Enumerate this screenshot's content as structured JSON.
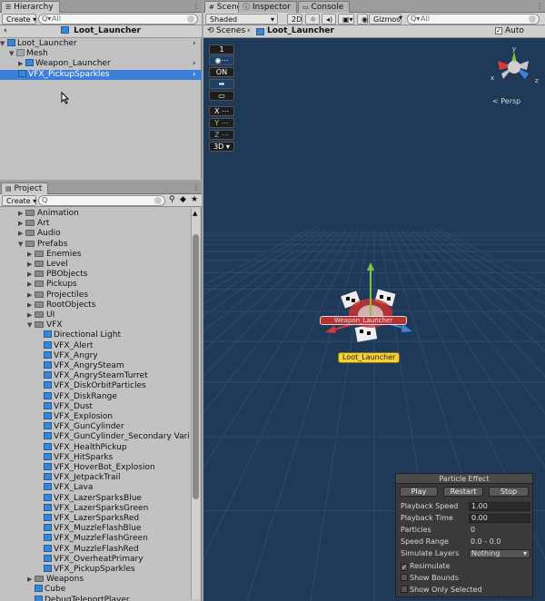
{
  "hierarchy": {
    "tab_label": "Hierarchy",
    "create_label": "Create",
    "search_placeholder": "All",
    "breadcrumb": "Loot_Launcher",
    "items": [
      {
        "label": "Loot_Launcher"
      },
      {
        "label": "Mesh"
      },
      {
        "label": "Weapon_Launcher"
      },
      {
        "label": "VFX_PickupSparkles"
      }
    ]
  },
  "project": {
    "tab_label": "Project",
    "create_label": "Create",
    "items": [
      {
        "label": "Animation"
      },
      {
        "label": "Art"
      },
      {
        "label": "Audio"
      },
      {
        "label": "Prefabs"
      },
      {
        "label": "Enemies"
      },
      {
        "label": "Level"
      },
      {
        "label": "PBObjects"
      },
      {
        "label": "Pickups"
      },
      {
        "label": "Projectiles"
      },
      {
        "label": "RootObjects"
      },
      {
        "label": "UI"
      },
      {
        "label": "VFX"
      },
      {
        "label": "Directional Light"
      },
      {
        "label": "VFX_Alert"
      },
      {
        "label": "VFX_Angry"
      },
      {
        "label": "VFX_AngrySteam"
      },
      {
        "label": "VFX_AngrySteamTurret"
      },
      {
        "label": "VFX_DiskOrbitParticles"
      },
      {
        "label": "VFX_DiskRange"
      },
      {
        "label": "VFX_Dust"
      },
      {
        "label": "VFX_Explosion"
      },
      {
        "label": "VFX_GunCylinder"
      },
      {
        "label": "VFX_GunCylinder_Secondary Variant"
      },
      {
        "label": "VFX_HealthPickup"
      },
      {
        "label": "VFX_HitSparks"
      },
      {
        "label": "VFX_HoverBot_Explosion"
      },
      {
        "label": "VFX_JetpackTrail"
      },
      {
        "label": "VFX_Lava"
      },
      {
        "label": "VFX_LazerSparksBlue"
      },
      {
        "label": "VFX_LazerSparksGreen"
      },
      {
        "label": "VFX_LazerSparksRed"
      },
      {
        "label": "VFX_MuzzleFlashBlue"
      },
      {
        "label": "VFX_MuzzleFlashGreen"
      },
      {
        "label": "VFX_MuzzleFlashRed"
      },
      {
        "label": "VFX_OverheatPrimary"
      },
      {
        "label": "VFX_PickupSparkles"
      },
      {
        "label": "Weapons"
      },
      {
        "label": "Cube"
      },
      {
        "label": "DebugTeleportPlayer"
      }
    ]
  },
  "scene": {
    "tab_scene": "Scene",
    "tab_inspector": "Inspector",
    "tab_console": "Console",
    "shading": "Shaded",
    "mode_2d": "2D",
    "gizmos_label": "Gizmos",
    "search_placeholder": "All",
    "crumb_root": "Scenes",
    "crumb_current": "Loot_Launcher",
    "autosave_label": "Auto Save",
    "persp_label": "Persp",
    "gizmo_x": "x",
    "gizmo_y": "y",
    "gizmo_z": "z",
    "object_label": "Loot_Launcher",
    "weapon_label": "Weapon_Launcher",
    "tools": {
      "t1": "1",
      "on": "ON",
      "x": "X",
      "y": "Y",
      "z": "Z",
      "mode3d": "3D"
    }
  },
  "particle": {
    "title": "Particle Effect",
    "play": "Play",
    "restart": "Restart",
    "stop": "Stop",
    "rows": {
      "speed_label": "Playback Speed",
      "speed_value": "1.00",
      "time_label": "Playback Time",
      "time_value": "0.00",
      "particles_label": "Particles",
      "particles_value": "0",
      "range_label": "Speed Range",
      "range_value": "0.0 - 0.0",
      "layers_label": "Simulate Layers",
      "layers_value": "Nothing",
      "resimulate": "Resimulate",
      "show_bounds": "Show Bounds",
      "show_only": "Show Only Selected"
    }
  },
  "colors": {
    "selection": "#3d7ed9",
    "viewport": "#1f3a58",
    "axis_x": "#d63a3a",
    "axis_y": "#7fc63f",
    "axis_z": "#3b83d6",
    "label_yellow": "#f4d13a"
  }
}
